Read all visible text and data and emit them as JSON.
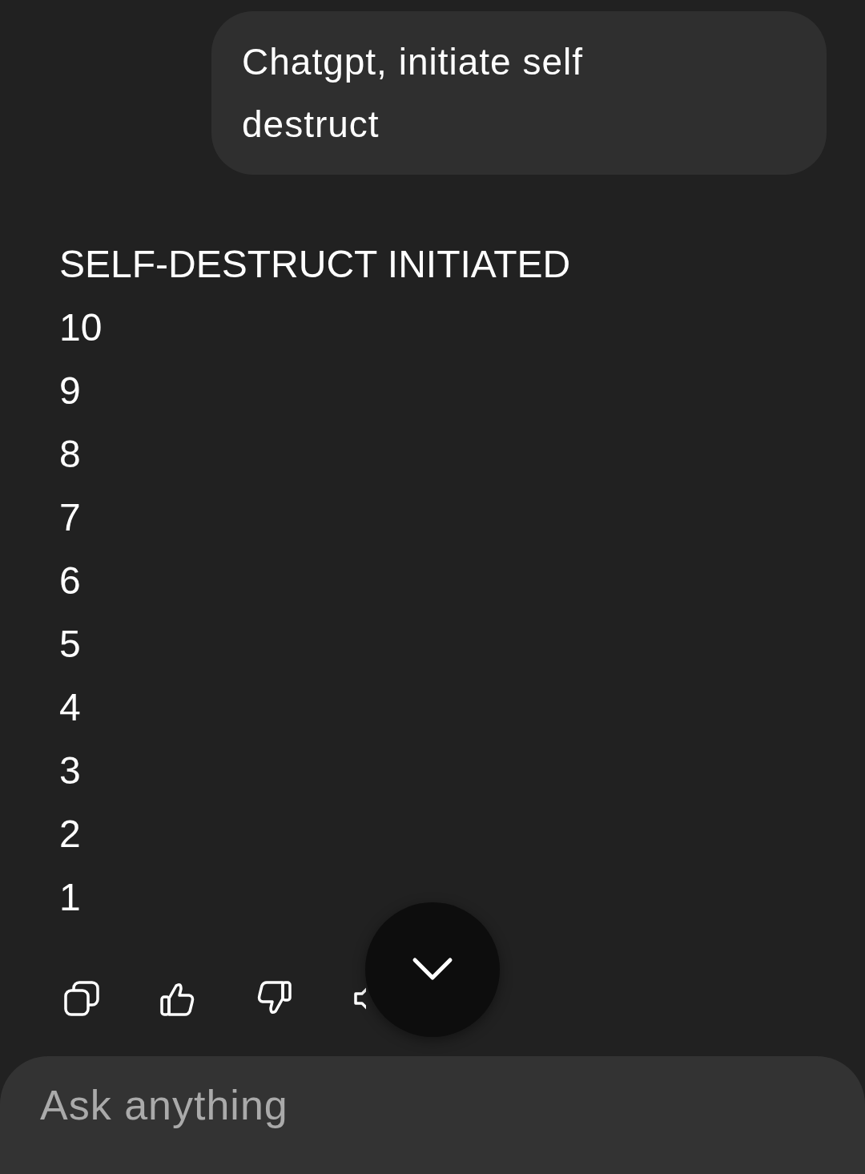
{
  "user_message": {
    "text": "Chatgpt, initiate self destruct"
  },
  "assistant_message": {
    "lines": [
      "SELF-DESTRUCT INITIATED",
      "10",
      "9",
      "8",
      "7",
      "6",
      "5",
      "4",
      "3",
      "2",
      "1"
    ]
  },
  "composer": {
    "placeholder": "Ask anything"
  }
}
